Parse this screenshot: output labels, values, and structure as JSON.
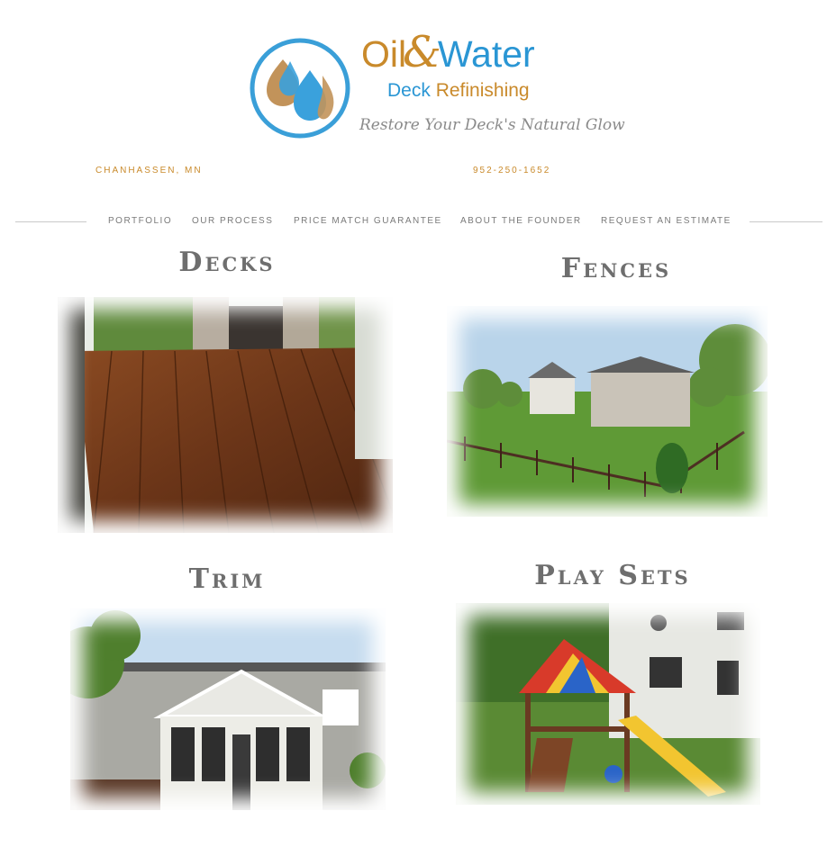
{
  "brand": {
    "name_oil": "Oil",
    "name_amp": "&",
    "name_water": "Water",
    "sub_deck": "Deck",
    "sub_refinishing": "Refinishing",
    "tagline": "Restore Your Deck's Natural Glow"
  },
  "contact": {
    "city": "CHANHASSEN, MN",
    "phone": "952-250-1652"
  },
  "nav": {
    "items": [
      "PORTFOLIO",
      "OUR PROCESS",
      "PRICE MATCH GUARANTEE",
      "ABOUT THE FOUNDER",
      "REQUEST AN ESTIMATE"
    ]
  },
  "sections": [
    {
      "title": "Decks"
    },
    {
      "title": "Fences"
    },
    {
      "title": "Trim"
    },
    {
      "title": "Play Sets"
    }
  ],
  "colors": {
    "brand_orange": "#c98a2b",
    "brand_blue": "#2a96d4",
    "nav_text": "#7a7a7a",
    "title_text": "#6e6e6e"
  }
}
